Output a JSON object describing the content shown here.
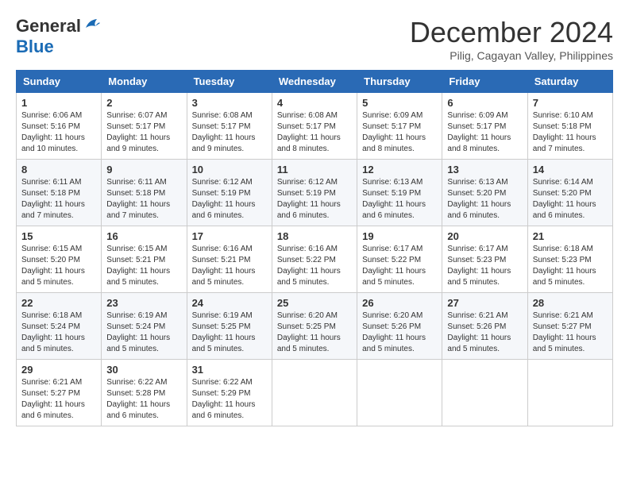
{
  "header": {
    "logo": {
      "general": "General",
      "blue": "Blue"
    },
    "title": "December 2024",
    "location": "Pilig, Cagayan Valley, Philippines"
  },
  "weekdays": [
    "Sunday",
    "Monday",
    "Tuesday",
    "Wednesday",
    "Thursday",
    "Friday",
    "Saturday"
  ],
  "weeks": [
    [
      {
        "day": "1",
        "sunrise": "6:06 AM",
        "sunset": "5:16 PM",
        "daylight": "11 hours and 10 minutes."
      },
      {
        "day": "2",
        "sunrise": "6:07 AM",
        "sunset": "5:17 PM",
        "daylight": "11 hours and 9 minutes."
      },
      {
        "day": "3",
        "sunrise": "6:08 AM",
        "sunset": "5:17 PM",
        "daylight": "11 hours and 9 minutes."
      },
      {
        "day": "4",
        "sunrise": "6:08 AM",
        "sunset": "5:17 PM",
        "daylight": "11 hours and 8 minutes."
      },
      {
        "day": "5",
        "sunrise": "6:09 AM",
        "sunset": "5:17 PM",
        "daylight": "11 hours and 8 minutes."
      },
      {
        "day": "6",
        "sunrise": "6:09 AM",
        "sunset": "5:17 PM",
        "daylight": "11 hours and 8 minutes."
      },
      {
        "day": "7",
        "sunrise": "6:10 AM",
        "sunset": "5:18 PM",
        "daylight": "11 hours and 7 minutes."
      }
    ],
    [
      {
        "day": "8",
        "sunrise": "6:11 AM",
        "sunset": "5:18 PM",
        "daylight": "11 hours and 7 minutes."
      },
      {
        "day": "9",
        "sunrise": "6:11 AM",
        "sunset": "5:18 PM",
        "daylight": "11 hours and 7 minutes."
      },
      {
        "day": "10",
        "sunrise": "6:12 AM",
        "sunset": "5:19 PM",
        "daylight": "11 hours and 6 minutes."
      },
      {
        "day": "11",
        "sunrise": "6:12 AM",
        "sunset": "5:19 PM",
        "daylight": "11 hours and 6 minutes."
      },
      {
        "day": "12",
        "sunrise": "6:13 AM",
        "sunset": "5:19 PM",
        "daylight": "11 hours and 6 minutes."
      },
      {
        "day": "13",
        "sunrise": "6:13 AM",
        "sunset": "5:20 PM",
        "daylight": "11 hours and 6 minutes."
      },
      {
        "day": "14",
        "sunrise": "6:14 AM",
        "sunset": "5:20 PM",
        "daylight": "11 hours and 6 minutes."
      }
    ],
    [
      {
        "day": "15",
        "sunrise": "6:15 AM",
        "sunset": "5:20 PM",
        "daylight": "11 hours and 5 minutes."
      },
      {
        "day": "16",
        "sunrise": "6:15 AM",
        "sunset": "5:21 PM",
        "daylight": "11 hours and 5 minutes."
      },
      {
        "day": "17",
        "sunrise": "6:16 AM",
        "sunset": "5:21 PM",
        "daylight": "11 hours and 5 minutes."
      },
      {
        "day": "18",
        "sunrise": "6:16 AM",
        "sunset": "5:22 PM",
        "daylight": "11 hours and 5 minutes."
      },
      {
        "day": "19",
        "sunrise": "6:17 AM",
        "sunset": "5:22 PM",
        "daylight": "11 hours and 5 minutes."
      },
      {
        "day": "20",
        "sunrise": "6:17 AM",
        "sunset": "5:23 PM",
        "daylight": "11 hours and 5 minutes."
      },
      {
        "day": "21",
        "sunrise": "6:18 AM",
        "sunset": "5:23 PM",
        "daylight": "11 hours and 5 minutes."
      }
    ],
    [
      {
        "day": "22",
        "sunrise": "6:18 AM",
        "sunset": "5:24 PM",
        "daylight": "11 hours and 5 minutes."
      },
      {
        "day": "23",
        "sunrise": "6:19 AM",
        "sunset": "5:24 PM",
        "daylight": "11 hours and 5 minutes."
      },
      {
        "day": "24",
        "sunrise": "6:19 AM",
        "sunset": "5:25 PM",
        "daylight": "11 hours and 5 minutes."
      },
      {
        "day": "25",
        "sunrise": "6:20 AM",
        "sunset": "5:25 PM",
        "daylight": "11 hours and 5 minutes."
      },
      {
        "day": "26",
        "sunrise": "6:20 AM",
        "sunset": "5:26 PM",
        "daylight": "11 hours and 5 minutes."
      },
      {
        "day": "27",
        "sunrise": "6:21 AM",
        "sunset": "5:26 PM",
        "daylight": "11 hours and 5 minutes."
      },
      {
        "day": "28",
        "sunrise": "6:21 AM",
        "sunset": "5:27 PM",
        "daylight": "11 hours and 5 minutes."
      }
    ],
    [
      {
        "day": "29",
        "sunrise": "6:21 AM",
        "sunset": "5:27 PM",
        "daylight": "11 hours and 6 minutes."
      },
      {
        "day": "30",
        "sunrise": "6:22 AM",
        "sunset": "5:28 PM",
        "daylight": "11 hours and 6 minutes."
      },
      {
        "day": "31",
        "sunrise": "6:22 AM",
        "sunset": "5:29 PM",
        "daylight": "11 hours and 6 minutes."
      },
      null,
      null,
      null,
      null
    ]
  ],
  "labels": {
    "sunrise_prefix": "Sunrise: ",
    "sunset_prefix": "Sunset: ",
    "daylight_prefix": "Daylight: "
  }
}
